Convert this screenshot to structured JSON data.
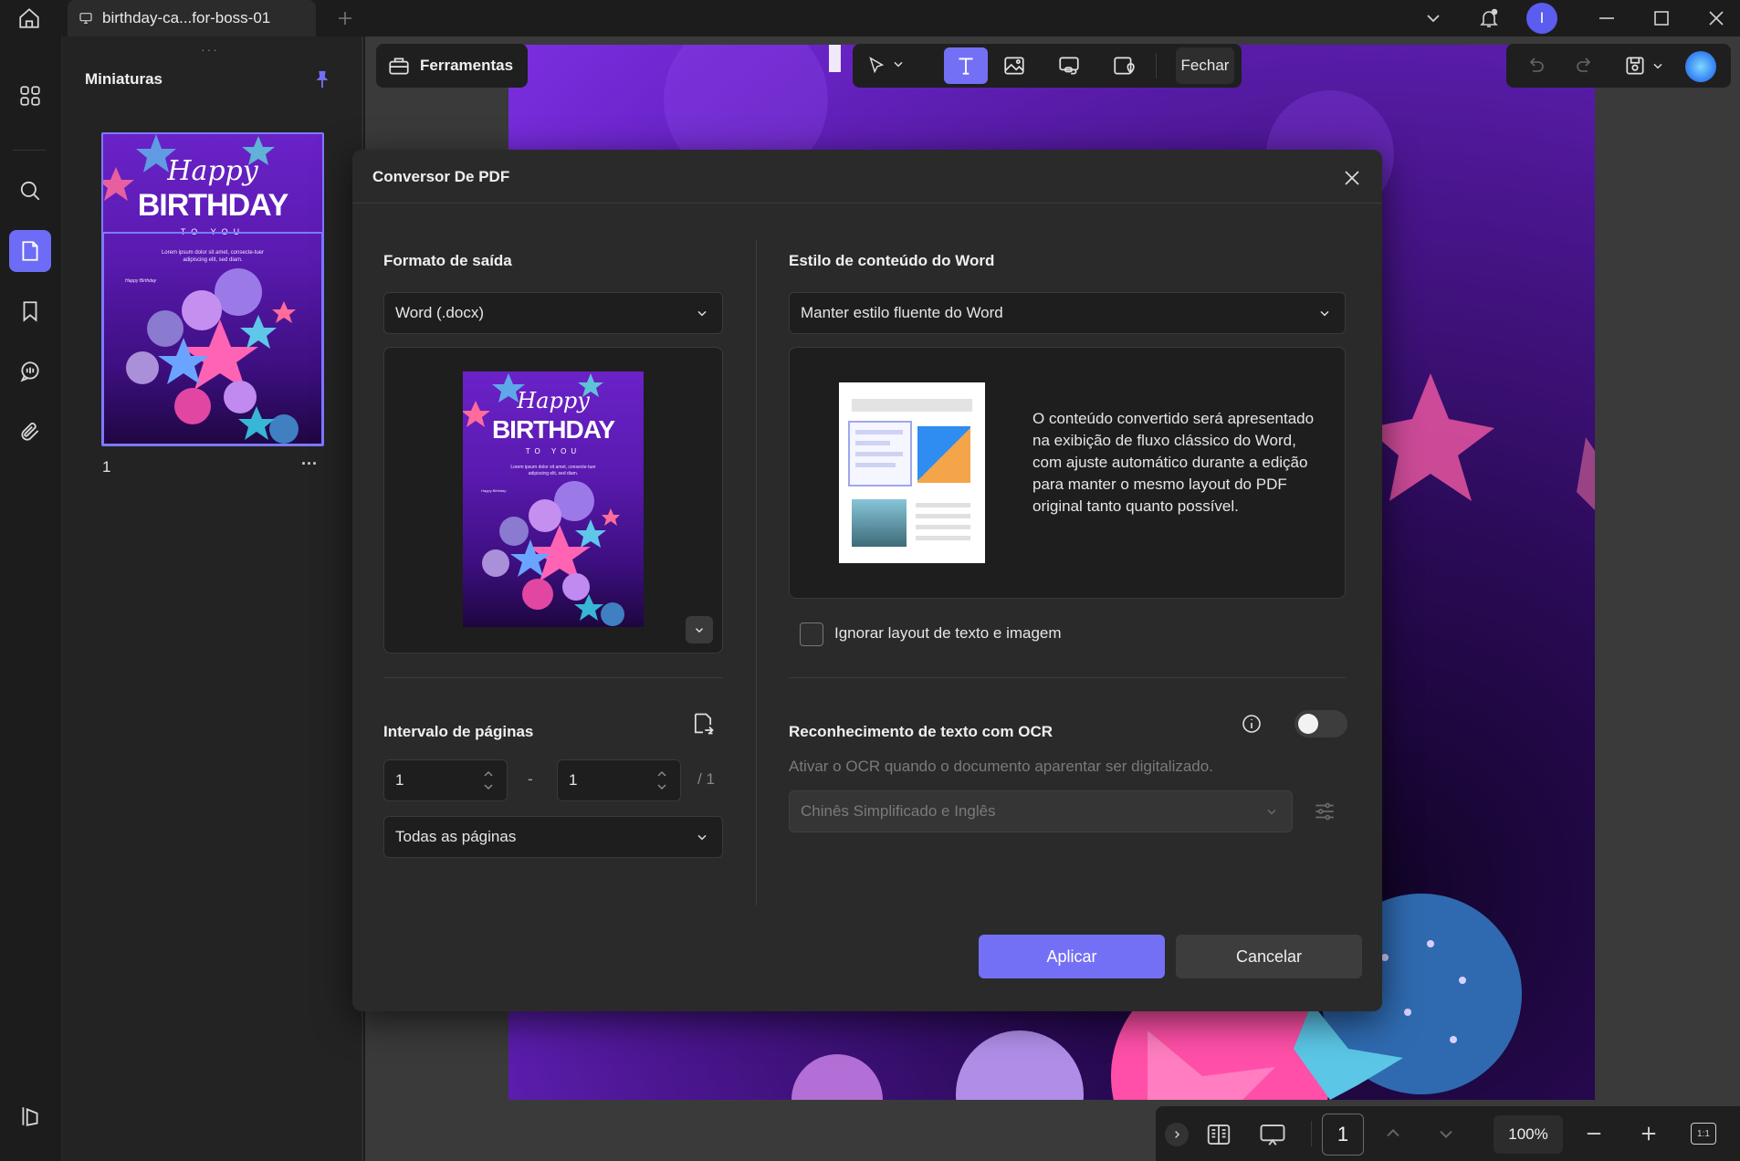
{
  "window": {
    "tab_title": "birthday-ca...for-boss-01",
    "avatar_letter": "I"
  },
  "thumbnails": {
    "title": "Miniaturas",
    "page_number": "1",
    "more": "···",
    "card_title_script": "Happy",
    "card_title_main": "BIRTHDAY",
    "card_subtitle": "TO YOU",
    "card_small_text": "Lorem ipsum dolor sit amet, consecte-tuer adipiscing elit, sed diam.",
    "card_signature": "Happy Birthday"
  },
  "toolbar": {
    "tools_label": "Ferramentas",
    "close_label": "Fechar"
  },
  "dialog": {
    "title": "Conversor De PDF",
    "output_format": {
      "title": "Formato de saída",
      "value": "Word (.docx)"
    },
    "page_range": {
      "title": "Intervalo de páginas",
      "from": "1",
      "separator": "-",
      "to": "1",
      "total": "/ 1",
      "scope": "Todas as páginas"
    },
    "word_style": {
      "title": "Estilo de conteúdo do Word",
      "value": "Manter estilo fluente do Word",
      "description": "O conteúdo convertido será apresentado na exibição de fluxo clássico do Word, com ajuste automático durante a edição para manter o mesmo layout do PDF original tanto quanto possível."
    },
    "ignore_layout_label": "Ignorar layout de texto e imagem",
    "ignore_layout_checked": false,
    "ocr": {
      "title": "Reconhecimento de texto com OCR",
      "enabled": false,
      "hint": "Ativar o OCR quando o documento aparentar ser digitalizado.",
      "language": "Chinês Simplificado e Inglês"
    },
    "apply_label": "Aplicar",
    "cancel_label": "Cancelar"
  },
  "bottombar": {
    "page": "1",
    "zoom": "100%",
    "fit_label": "1:1"
  },
  "colors": {
    "accent": "#7470f5",
    "dialog_bg": "#2a2a2a",
    "panel_bg": "#1e1e1e"
  }
}
